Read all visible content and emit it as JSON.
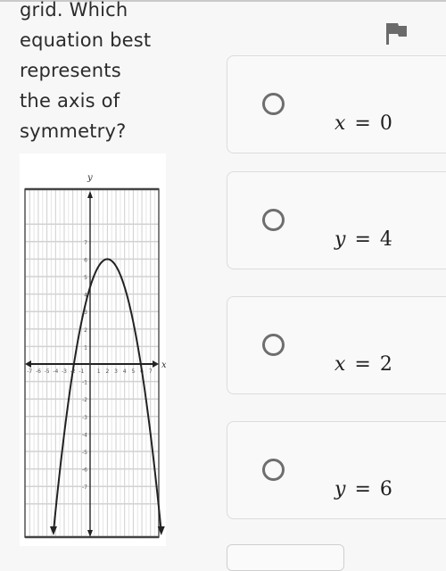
{
  "question": {
    "lines": [
      "grid. Which",
      "equation best",
      "represents",
      "the axis of",
      "symmetry?"
    ]
  },
  "flag": {
    "icon": "flag-icon"
  },
  "graph": {
    "x_axis_label": "x",
    "y_axis_label": "y",
    "x_ticks": [
      "-7",
      "-6",
      "-5",
      "-4",
      "-3",
      "-2",
      "-1",
      "1",
      "2",
      "3",
      "4",
      "5",
      "6",
      "7"
    ],
    "y_ticks": [
      "7",
      "6",
      "5",
      "4",
      "3",
      "2",
      "1",
      "-1",
      "-2",
      "-3",
      "-4",
      "-5",
      "-6",
      "-7"
    ],
    "x_range": [
      -7,
      7
    ],
    "y_range": [
      -7,
      7
    ],
    "parabola": {
      "vertex": [
        2,
        6
      ],
      "a": -0.4,
      "opens": "down"
    }
  },
  "options": [
    {
      "var": "x",
      "op": "=",
      "value": "0",
      "selected": false
    },
    {
      "var": "y",
      "op": "=",
      "value": "4",
      "selected": false
    },
    {
      "var": "x",
      "op": "=",
      "value": "2",
      "selected": false
    },
    {
      "var": "y",
      "op": "=",
      "value": "6",
      "selected": false
    }
  ],
  "colors": {
    "text": "#2b2b2b",
    "radio_border": "#6e6e6e",
    "card_border": "#dcdcdc",
    "flag": "#6b6b6b"
  }
}
